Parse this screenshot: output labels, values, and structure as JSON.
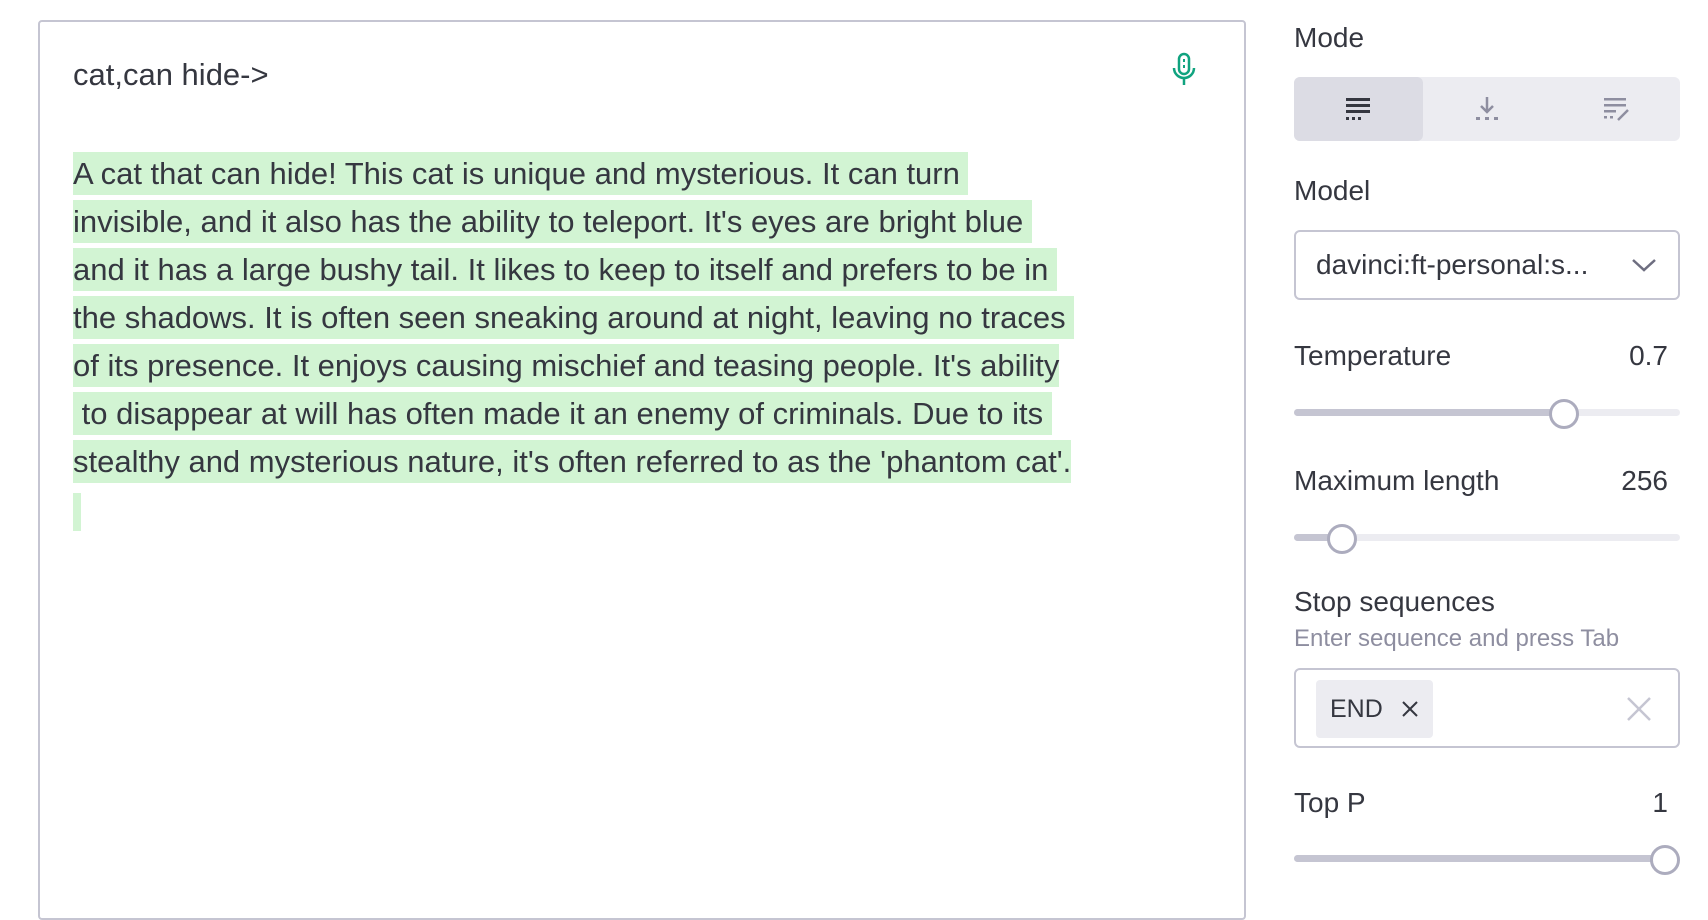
{
  "editor": {
    "prompt": "cat,can hide->",
    "completion_lines": [
      "A cat that can hide! This cat is unique and mysterious. It can turn ",
      "invisible, and it also has the ability to teleport. It's eyes are bright blue ",
      "and it has a large bushy tail. It likes to keep to itself and prefers to be in ",
      "the shadows. It is often seen sneaking around at night, leaving no traces ",
      "of its presence. It enjoys causing mischief and teasing people. It's ability",
      " to disappear at will has often made it an enemy of criminals. Due to its ",
      "stealthy and mysterious nature, it's often referred to as the 'phantom cat'."
    ]
  },
  "panel": {
    "mode": {
      "label": "Mode",
      "options": [
        "complete-icon",
        "insert-icon",
        "edit-icon"
      ],
      "selected_index": 0
    },
    "model": {
      "label": "Model",
      "selected": "davinci:ft-personal:s..."
    },
    "temperature": {
      "label": "Temperature",
      "value": "0.7",
      "fraction": 0.7
    },
    "max_length": {
      "label": "Maximum length",
      "value": "256",
      "fraction": 0.125
    },
    "stop_sequences": {
      "label": "Stop sequences",
      "hint": "Enter sequence and press Tab",
      "chips": [
        "END"
      ]
    },
    "top_p": {
      "label": "Top P",
      "value": "1",
      "fraction": 1.0
    }
  },
  "colors": {
    "accent_green": "#10a37f",
    "highlight": "#d2f4d3",
    "border": "#c5c5d2"
  }
}
